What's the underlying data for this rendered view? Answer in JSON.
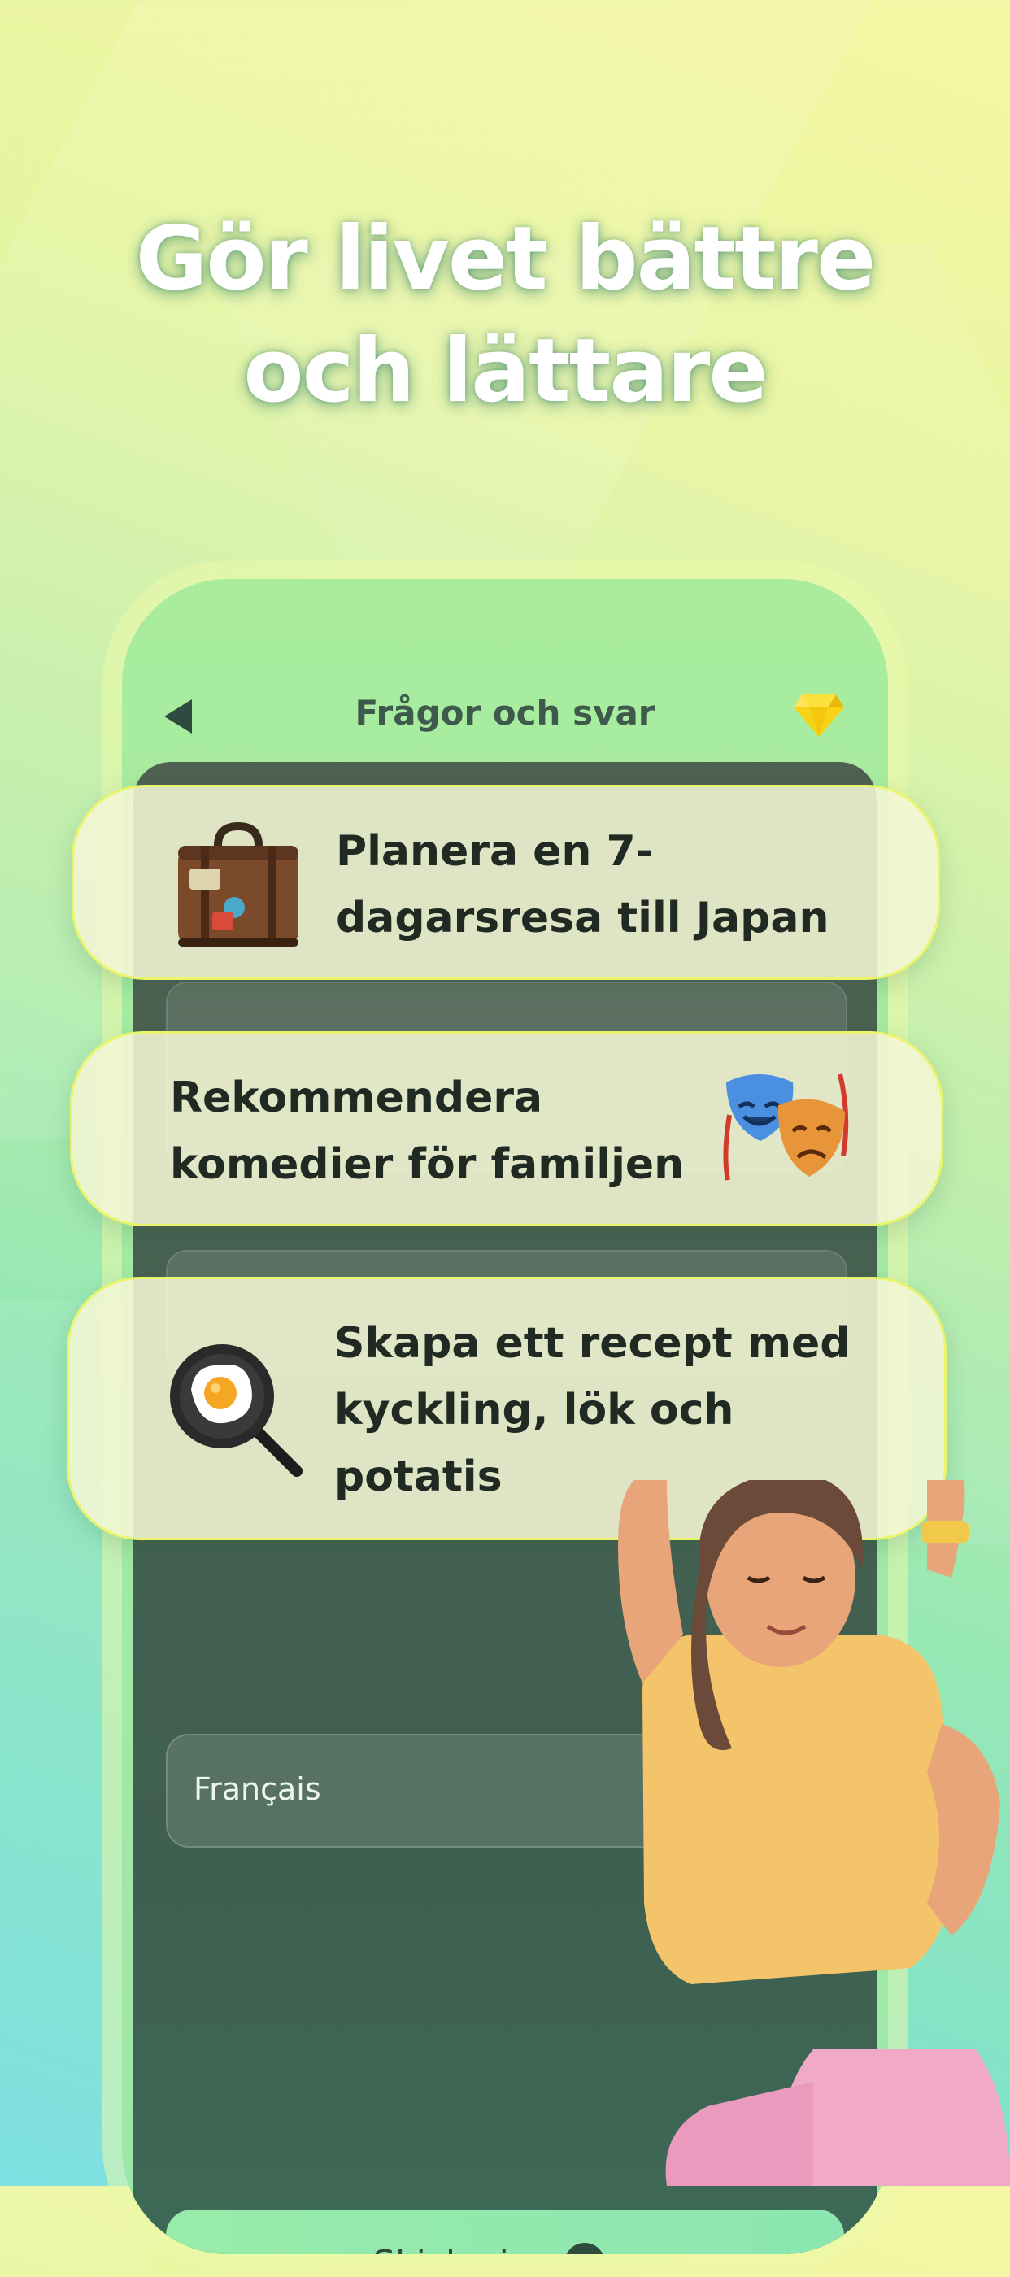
{
  "headline": {
    "line1": "Gör livet bättre",
    "line2": "och lättare"
  },
  "phone": {
    "title": "Frågor och svar",
    "back_icon": "back-triangle-icon",
    "premium_icon": "diamond-icon",
    "language_value": "Français",
    "submit_label": "Skicka in",
    "submit_icon": "arrow-right-circle-icon"
  },
  "cards": [
    {
      "text_line1": "Planera en 7-",
      "text_line2": "dagarsresa till Japan",
      "icon": "suitcase-icon"
    },
    {
      "text_line1": "Rekommendera",
      "text_line2": "komedier för familjen",
      "icon": "theater-masks-icon"
    },
    {
      "text_line1": "Skapa ett recept med",
      "text_line2": "kyckling, lök och",
      "text_line3": "potatis",
      "icon": "frying-pan-egg-icon"
    }
  ],
  "colors": {
    "card_border": "#eaf56a",
    "card_bg": "#f4f6d4",
    "screen_dark": "#466252",
    "submit_bg": "#98ecaa"
  }
}
